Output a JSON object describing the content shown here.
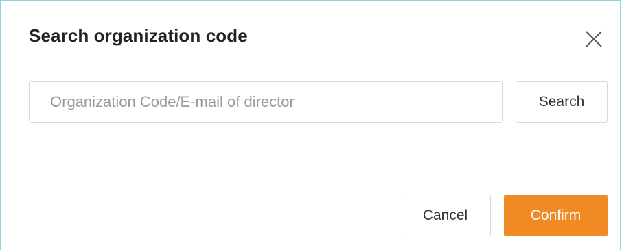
{
  "dialog": {
    "title": "Search organization code",
    "close_icon": "close-icon"
  },
  "search": {
    "placeholder": "Organization Code/E-mail of director",
    "value": "",
    "button_label": "Search"
  },
  "footer": {
    "cancel_label": "Cancel",
    "confirm_label": "Confirm"
  },
  "colors": {
    "accent": "#f08a24",
    "frame_border": "#8fd3dc",
    "input_border": "#d9d9d9"
  }
}
